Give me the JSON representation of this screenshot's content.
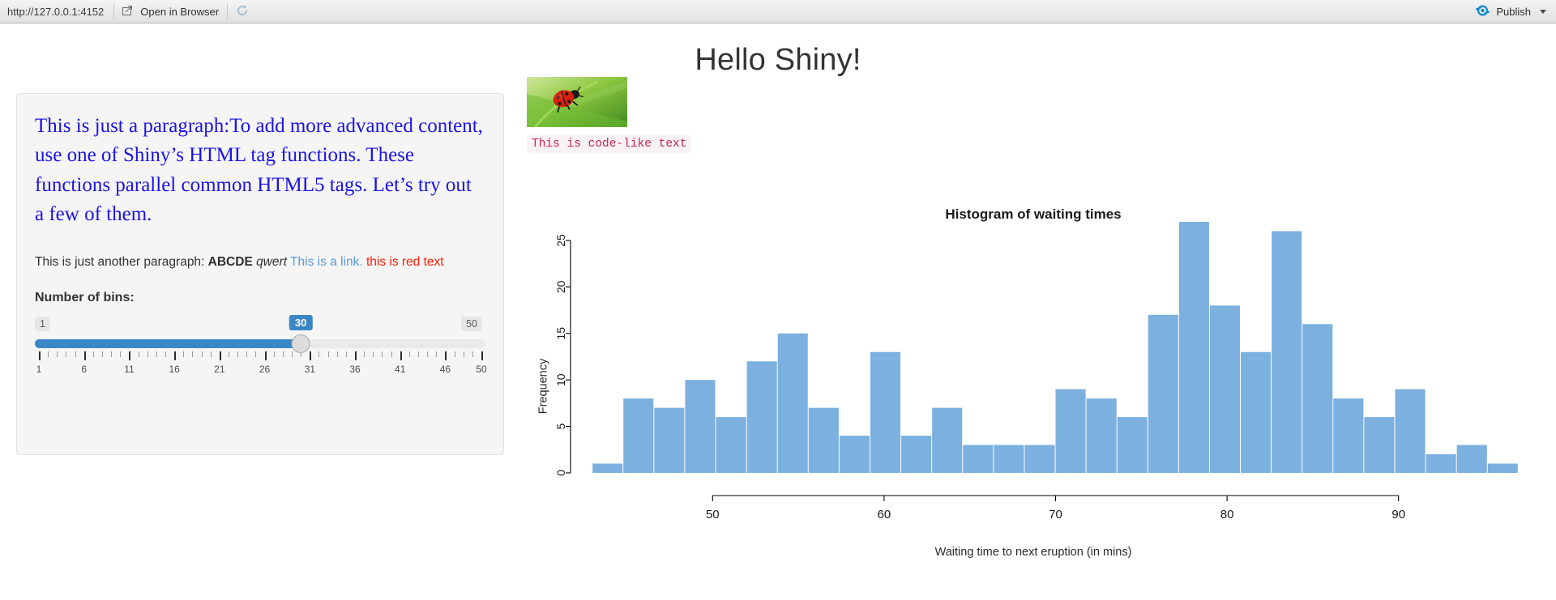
{
  "toolbar": {
    "url": "http://127.0.0.1:4152",
    "open_in_browser_label": "Open in Browser",
    "refresh_icon": "refresh-icon",
    "open_icon": "open-external-icon",
    "publish_label": "Publish",
    "publish_icon": "publish-icon",
    "caret_icon": "chevron-down-icon"
  },
  "app": {
    "title": "Hello Shiny!"
  },
  "sidebar": {
    "blue_paragraph": "This is just a paragraph:To add more advanced content, use one of Shiny’s HTML tag functions. These functions parallel common HTML5 tags. Let’s try out a few of them.",
    "second_paragraph": {
      "lead": "This is just another paragraph: ",
      "bold": "ABCDE",
      "space1": " ",
      "italic": "qwert",
      "space2": " ",
      "link": "This is a link.",
      "space3": " ",
      "red": "this is red text"
    },
    "slider": {
      "label": "Number of bins:",
      "min": "1",
      "max": "50",
      "value": "30",
      "tick_labels": [
        "1",
        "6",
        "11",
        "16",
        "21",
        "26",
        "31",
        "36",
        "41",
        "46",
        "50"
      ]
    }
  },
  "right": {
    "image_alt": "ladybug-photo",
    "code_text": "This is code-like text"
  },
  "chart_data": {
    "type": "bar",
    "title": "Histogram of waiting times",
    "xlabel": "Waiting time to next eruption (in mins)",
    "ylabel": "Frequency",
    "bar_color": "#7cb0de",
    "grid": false,
    "legend": null,
    "xlim": [
      42,
      98
    ],
    "ylim": [
      0,
      27
    ],
    "x_ticks": [
      50,
      60,
      70,
      80,
      90
    ],
    "y_ticks": [
      0,
      5,
      10,
      15,
      20,
      25
    ],
    "bin_width": 1.8,
    "bin_starts": [
      43.0,
      44.8,
      46.6,
      48.4,
      50.2,
      52.0,
      53.8,
      55.6,
      57.4,
      59.2,
      61.0,
      62.8,
      64.6,
      66.4,
      68.2,
      70.0,
      71.8,
      73.6,
      75.4,
      77.2,
      79.0,
      80.8,
      82.6,
      84.4,
      86.2,
      88.0,
      89.8,
      91.6,
      93.4,
      95.2
    ],
    "values": [
      1,
      8,
      7,
      10,
      6,
      12,
      15,
      7,
      4,
      13,
      4,
      7,
      3,
      3,
      3,
      9,
      8,
      6,
      17,
      27,
      18,
      13,
      26,
      16,
      8,
      6,
      9,
      2,
      3,
      1
    ]
  }
}
